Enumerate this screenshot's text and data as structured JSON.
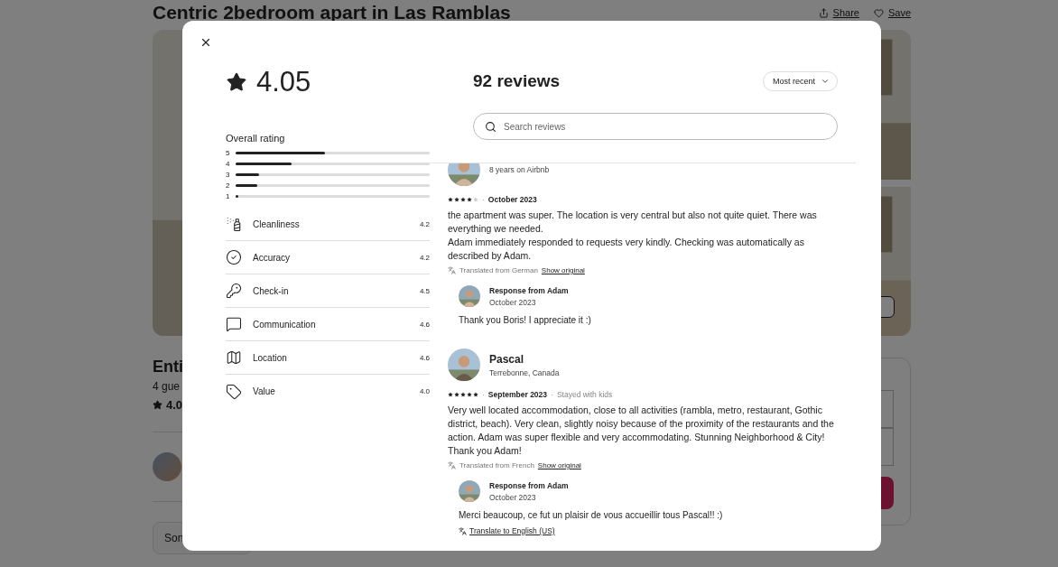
{
  "page": {
    "title": "Centric 2bedroom apart in Las Ramblas",
    "actions": [
      {
        "kind": "share",
        "label": "Share"
      },
      {
        "kind": "save",
        "label": "Save"
      }
    ],
    "listing_heading": "Enti",
    "listing_meta": "4 gue",
    "listing_rating": "4.0",
    "section_button": "Son"
  },
  "modal": {
    "overall_score": "4.05",
    "overall_label": "Overall rating",
    "distribution": [
      {
        "label": "5",
        "level": 0.46
      },
      {
        "label": "4",
        "level": 0.29
      },
      {
        "label": "3",
        "level": 0.12
      },
      {
        "label": "2",
        "level": 0.11
      },
      {
        "label": "1",
        "level": 0.015
      }
    ],
    "categories": [
      {
        "kind": "cleanliness",
        "label": "Cleanliness",
        "score": "4.2"
      },
      {
        "kind": "accuracy",
        "label": "Accuracy",
        "score": "4.2"
      },
      {
        "kind": "checkin",
        "label": "Check-in",
        "score": "4.5"
      },
      {
        "kind": "communication",
        "label": "Communication",
        "score": "4.6"
      },
      {
        "kind": "location",
        "label": "Location",
        "score": "4.6"
      },
      {
        "kind": "value",
        "label": "Value",
        "score": "4.0"
      }
    ],
    "reviews_title": "92 reviews",
    "sort": "Most recent",
    "search": {
      "placeholder": "Search reviews"
    },
    "reviews": [
      {
        "meta": "8 years on Airbnb",
        "stars": 4,
        "separator": "·",
        "date": "October 2023",
        "text": "the apartment was super. The location is very central but also not quite quiet. There was everything we needed.\nAdam immediately responded to requests very kindly. Checking was automatically as described by Adam.",
        "note": "Translated from German",
        "note_link": "Show original",
        "response": {
          "title": "Response from Adam",
          "date": "October 2023",
          "text": "Thank you Boris! I appreciate it :)"
        }
      },
      {
        "name": "Pascal",
        "meta": "Terrebonne, Canada",
        "stars": 5,
        "separator": "·",
        "date": "September 2023",
        "stay_separator": "·",
        "stay": "Stayed with kids",
        "text": "Very well located accommodation, close to all activities (rambla, metro, restaurant, Gothic district, beach). Very clean, slightly noisy because of the proximity of the restaurants and the action. Adam was super flexible and very accommodating. Stunning Neighborhood & City! Thank you Adam!",
        "note": "Translated from French",
        "note_link": "Show original",
        "response": {
          "title": "Response from Adam",
          "date": "October 2023",
          "text": "Merci beaucoup, ce fut un plaisir de vous accueillir tous Pascal!! :)",
          "translate_link": "Translate to English (US)"
        }
      }
    ]
  }
}
